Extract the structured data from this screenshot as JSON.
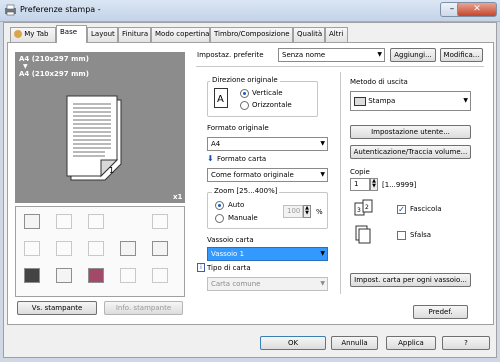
{
  "window": {
    "title": "Preferenze stampa -"
  },
  "tabs": [
    {
      "label": "My Tab"
    },
    {
      "label": "Base"
    },
    {
      "label": "Layout"
    },
    {
      "label": "Finitura"
    },
    {
      "label": "Modo copertina"
    },
    {
      "label": "Timbro/Composizione"
    },
    {
      "label": "Qualità"
    },
    {
      "label": "Altri"
    }
  ],
  "preview": {
    "paper_line1": "A4 (210x297 mm)",
    "paper_line2": "A4 (210x297 mm)",
    "copies_badge": "x1"
  },
  "left_buttons": {
    "printer_view": "Vs. stampante",
    "printer_info": "Info. stampante"
  },
  "favorites": {
    "label": "Impostaz. preferite",
    "value": "Senza nome",
    "add": "Aggiungi...",
    "edit": "Modifica..."
  },
  "orientation": {
    "label": "Direzione originale",
    "portrait": "Verticale",
    "landscape": "Orizzontale"
  },
  "original_size": {
    "label": "Formato originale",
    "value": "A4"
  },
  "paper_size": {
    "label": "Formato carta",
    "value": "Come formato originale"
  },
  "zoom": {
    "label": "Zoom [25...400%]",
    "auto": "Auto",
    "manual": "Manuale",
    "value": "100",
    "unit": "%"
  },
  "paper_tray": {
    "label": "Vassoio carta",
    "value": "Vassoio 1"
  },
  "paper_type": {
    "label": "Tipo di carta",
    "value": "Carta comune"
  },
  "output": {
    "label": "Metodo di uscita",
    "value": "Stampa"
  },
  "user_settings": {
    "label": "Impostazione utente..."
  },
  "auth": {
    "label": "Autenticazione/Traccia volume..."
  },
  "copies": {
    "label": "Copie",
    "value": "1",
    "range": "[1...9999]",
    "collate": "Fascicola",
    "offset": "Sfalsa"
  },
  "tray_settings": {
    "label": "Impost. carta per ogni vassoio..."
  },
  "default_btn": {
    "label": "Predef."
  },
  "footer": {
    "ok": "OK",
    "cancel": "Annulla",
    "apply": "Applica",
    "help": "?"
  },
  "colors": {
    "accent": "#3399ff",
    "preview_bg": "#8c8c8c",
    "panel": "#f0f0f0"
  }
}
